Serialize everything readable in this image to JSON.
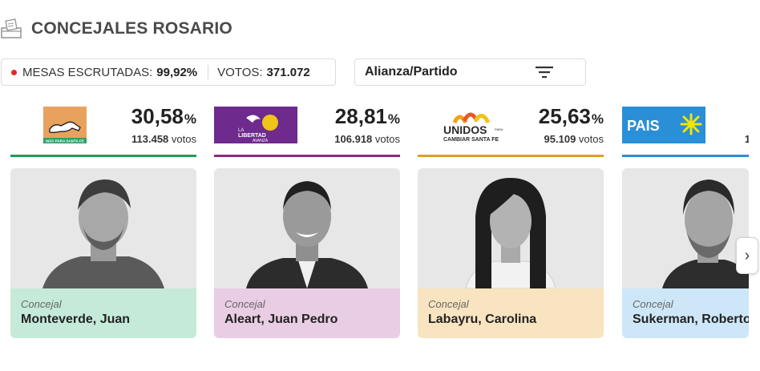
{
  "header": {
    "title": "CONCEJALES ROSARIO",
    "icon": "ballot-box-icon"
  },
  "stats": {
    "mesas_label": "MESAS ESCRUTADAS:",
    "mesas_value": "99,92%",
    "votos_label": "VOTOS:",
    "votos_value": "371.072",
    "live_color": "#e3262f"
  },
  "filter": {
    "label": "Alianza/Partido",
    "icon": "filter-icon"
  },
  "cards": [
    {
      "party_logo": "Más para Santa Fe",
      "logo_text": "MÁS PARA SANTA FE",
      "pct_value": "30,58",
      "pct_symbol": "%",
      "votes_value": "113.458",
      "votes_label": "votos",
      "color": "#1f9d55",
      "bg": "#c5ead9",
      "role": "Concejal",
      "name": "Monteverde, Juan"
    },
    {
      "party_logo": "La Libertad Avanza",
      "logo_text_1": "LA",
      "logo_text_2": "LIBERTAD",
      "logo_text_3": "AVANZA",
      "pct_value": "28,81",
      "pct_symbol": "%",
      "votes_value": "106.918",
      "votes_label": "votos",
      "color": "#8b2c7e",
      "bg": "#e9cde4",
      "role": "Concejal",
      "name": "Aleart, Juan Pedro"
    },
    {
      "party_logo": "Unidos para Cambiar Santa Fe",
      "logo_text_1": "UNIDOS",
      "logo_text_2": "PARA",
      "logo_text_3": "CAMBIAR SANTA FE",
      "pct_value": "25,63",
      "pct_symbol": "%",
      "votes_value": "95.109",
      "votes_label": "votos",
      "color": "#e0a020",
      "bg": "#f8e4c0",
      "role": "Concejal",
      "name": "Labayru, Carolina"
    },
    {
      "party_logo": "País",
      "logo_text": "PAIS",
      "votes_value": "1",
      "color": "#2a8fd6",
      "bg": "#cde7f8",
      "role": "Concejal",
      "name": "Sukerman, Roberto"
    }
  ],
  "carousel": {
    "next": "›"
  }
}
